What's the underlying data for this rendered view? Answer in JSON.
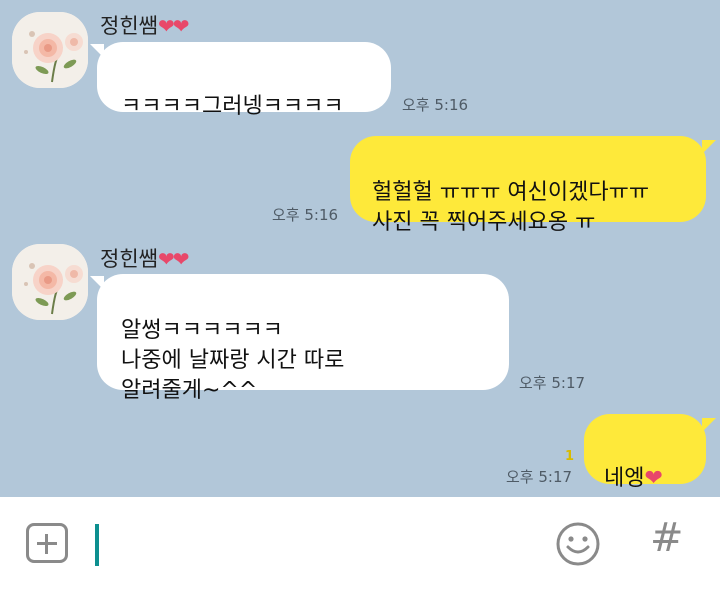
{
  "messages": {
    "m1": {
      "sender": "정힌쌤",
      "sender_hearts": "❤❤",
      "text": "ㅋㅋㅋㅋ그러넹ㅋㅋㅋㅋ",
      "time": "오후 5:16"
    },
    "m2": {
      "text": "헐헐헐 ㅠㅠㅠ 여신이겠다ㅠㅠ\n사진 꼭 찍어주세요옹 ㅠ",
      "time": "오후 5:16"
    },
    "m3": {
      "sender": "정힌쌤",
      "sender_hearts": "❤❤",
      "text": "알썽ㅋㅋㅋㅋㅋㅋ\n나중에 날짜랑 시간 따로\n알려줄게~^^",
      "time": "오후 5:17"
    },
    "m4": {
      "text": "네엥",
      "heart": "❤",
      "time": "오후 5:17",
      "unread": "1"
    }
  },
  "input_bar": {
    "add_icon": "plus-square-icon",
    "emoji_icon": "smiley-icon",
    "hash_label": "#",
    "text_value": ""
  },
  "colors": {
    "chat_bg": "#b2c7d9",
    "incoming_bubble": "#ffffff",
    "outgoing_bubble": "#fee93a",
    "heart": "#e8486a",
    "cursor": "#0d8f8f"
  }
}
